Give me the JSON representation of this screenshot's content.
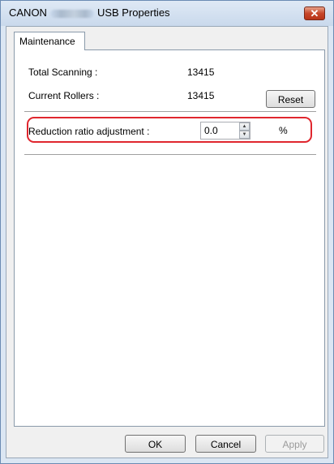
{
  "window": {
    "title_prefix": "CANON",
    "title_suffix": "USB Properties",
    "close_glyph": "✕"
  },
  "tabs": [
    {
      "label": "Maintenance",
      "active": true
    }
  ],
  "maintenance": {
    "total_scanning_label": "Total Scanning :",
    "total_scanning_value": "13415",
    "current_rollers_label": "Current Rollers :",
    "current_rollers_value": "13415",
    "reset_label": "Reset",
    "reduction_label": "Reduction ratio adjustment :",
    "reduction_value": "0.0",
    "reduction_unit": "%"
  },
  "footer": {
    "ok_label": "OK",
    "cancel_label": "Cancel",
    "apply_label": "Apply",
    "apply_enabled": false
  },
  "colors": {
    "highlight_border": "#e0262e",
    "close_button": "#c7472a"
  },
  "icons": {
    "spin_up": "▲",
    "spin_down": "▼"
  }
}
